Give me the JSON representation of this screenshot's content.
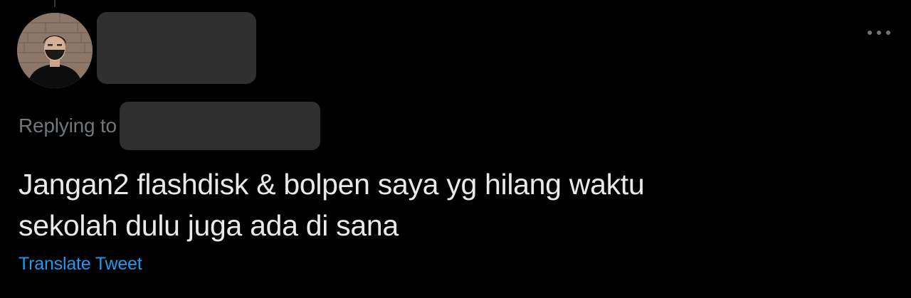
{
  "tweet": {
    "reply_prefix": "Replying to",
    "text": "Jangan2 flashdisk & bolpen saya yg hilang waktu\nsekolah dulu juga ada di sana",
    "translate_label": "Translate Tweet"
  },
  "icons": {
    "more": "more-horizontal-icon"
  },
  "colors": {
    "background": "#000000",
    "text_primary": "#e7e9ea",
    "text_secondary": "#71767b",
    "link": "#1d9bf0",
    "redaction": "#2f2f2f"
  }
}
